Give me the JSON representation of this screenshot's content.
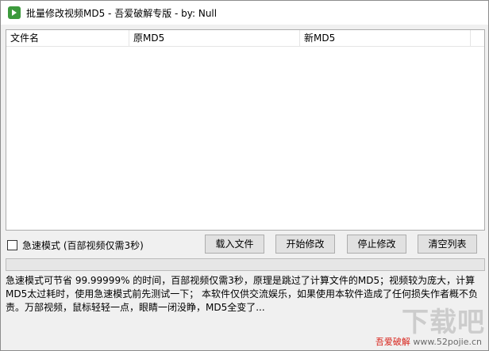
{
  "window": {
    "title": "批量修改视频MD5 - 吾爱破解专版 - by: Null",
    "icon": "video-icon",
    "icon_color": "#3c9a3c"
  },
  "list": {
    "columns": [
      "文件名",
      "原MD5",
      "新MD5"
    ],
    "rows": []
  },
  "controls": {
    "fast_mode_label": "急速模式 (百部视频仅需3秒)",
    "fast_mode_checked": false,
    "load_button": "载入文件",
    "start_button": "开始修改",
    "stop_button": "停止修改",
    "clear_button": "清空列表"
  },
  "progress": {
    "value": 0
  },
  "description": "急速模式可节省 99.99999% 的时间，百部视频仅需3秒，原理是跳过了计算文件的MD5；视频较为庞大，计算MD5太过耗时，使用急速模式前先测试一下； 本软件仅供交流娱乐，如果使用本软件造成了任何损失作者概不负责。万部视频，鼠标轻轻一点，眼睛一闭没睁，MD5全变了...",
  "watermark": {
    "logo_text": "下载吧",
    "site_name": "吾爱破解",
    "site_url": "www.52pojie.cn",
    "accent_color": "#d8231b"
  }
}
